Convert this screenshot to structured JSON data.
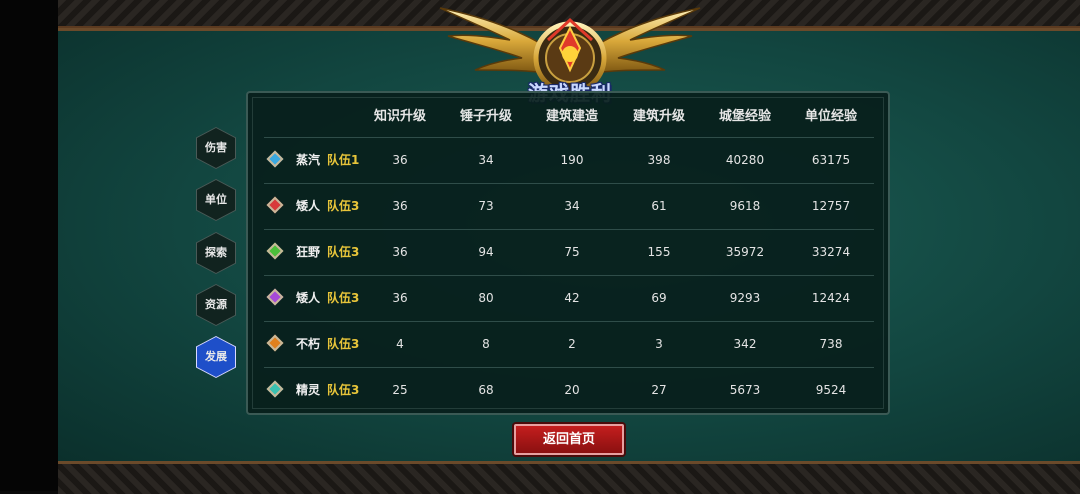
{
  "title": "游戏胜利",
  "side_tabs": [
    {
      "label": "伤害",
      "active": false
    },
    {
      "label": "单位",
      "active": false
    },
    {
      "label": "探索",
      "active": false
    },
    {
      "label": "资源",
      "active": false
    },
    {
      "label": "发展",
      "active": true
    }
  ],
  "table": {
    "headers": [
      "知识升级",
      "锤子升级",
      "建筑建造",
      "建筑升级",
      "城堡经验",
      "单位经验"
    ],
    "rows": [
      {
        "race": "蒸汽",
        "team": "队伍1",
        "gem_color": "#3aa8e0",
        "values": [
          "36",
          "34",
          "190",
          "398",
          "40280",
          "63175"
        ]
      },
      {
        "race": "矮人",
        "team": "队伍3",
        "gem_color": "#d83a3a",
        "values": [
          "36",
          "73",
          "34",
          "61",
          "9618",
          "12757"
        ]
      },
      {
        "race": "狂野",
        "team": "队伍3",
        "gem_color": "#4bbf3a",
        "values": [
          "36",
          "94",
          "75",
          "155",
          "35972",
          "33274"
        ]
      },
      {
        "race": "矮人",
        "team": "队伍3",
        "gem_color": "#a64ad8",
        "values": [
          "36",
          "80",
          "42",
          "69",
          "9293",
          "12424"
        ]
      },
      {
        "race": "不朽",
        "team": "队伍3",
        "gem_color": "#e0801e",
        "values": [
          "4",
          "8",
          "2",
          "3",
          "342",
          "738"
        ]
      },
      {
        "race": "精灵",
        "team": "队伍3",
        "gem_color": "#3ac0b0",
        "values": [
          "25",
          "68",
          "20",
          "27",
          "5673",
          "9524"
        ]
      }
    ]
  },
  "home_button": "返回首页",
  "colors": {
    "team_label": "#e8c53a",
    "active_tab": "#1e4fc9",
    "button": "#c41e1e"
  }
}
